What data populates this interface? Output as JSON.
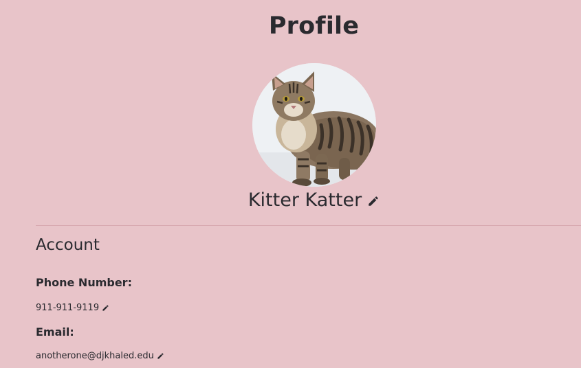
{
  "page": {
    "title": "Profile"
  },
  "profile": {
    "name": "Kitter Katter",
    "avatar_subject": "tabby cat photo"
  },
  "account": {
    "heading": "Account",
    "phone_label": "Phone Number:",
    "phone_value": "911-911-9119",
    "email_label": "Email:",
    "email_value": "anotherone@djkhaled.edu"
  },
  "icons": {
    "edit": "pencil-icon"
  },
  "colors": {
    "background": "#e8c4c9",
    "text": "#2a2a2f",
    "divider": "#d7a9b0"
  }
}
